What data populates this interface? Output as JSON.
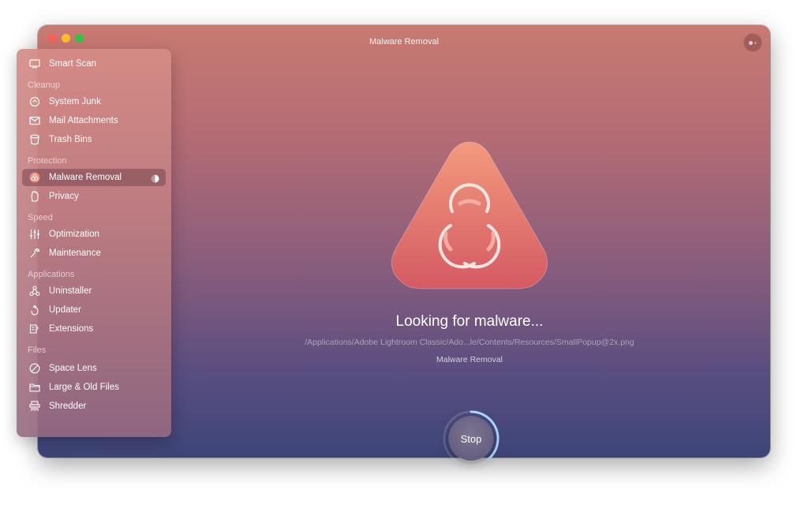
{
  "window": {
    "title": "Malware Removal"
  },
  "sidebar": {
    "smart_scan": "Smart Scan",
    "sections": {
      "cleanup": "Cleanup",
      "protection": "Protection",
      "speed": "Speed",
      "applications": "Applications",
      "files": "Files"
    },
    "items": {
      "system_junk": "System Junk",
      "mail_attachments": "Mail Attachments",
      "trash_bins": "Trash Bins",
      "malware_removal": "Malware Removal",
      "privacy": "Privacy",
      "optimization": "Optimization",
      "maintenance": "Maintenance",
      "uninstaller": "Uninstaller",
      "updater": "Updater",
      "extensions": "Extensions",
      "space_lens": "Space Lens",
      "large_old_files": "Large & Old Files",
      "shredder": "Shredder"
    },
    "active_item": "Malware Removal"
  },
  "main": {
    "headline": "Looking for malware...",
    "current_path": "/Applications/Adobe Lightroom Classic/Ado...le/Contents/Resources/SmallPopup@2x.png",
    "module_label": "Malware Removal",
    "stop_label": "Stop"
  },
  "colors": {
    "accent_shield": "#e07a6a",
    "close": "#fc5f57",
    "minimize": "#fdbc2e",
    "maximize": "#2ac840",
    "progress_ring": "#a7d8ff"
  }
}
